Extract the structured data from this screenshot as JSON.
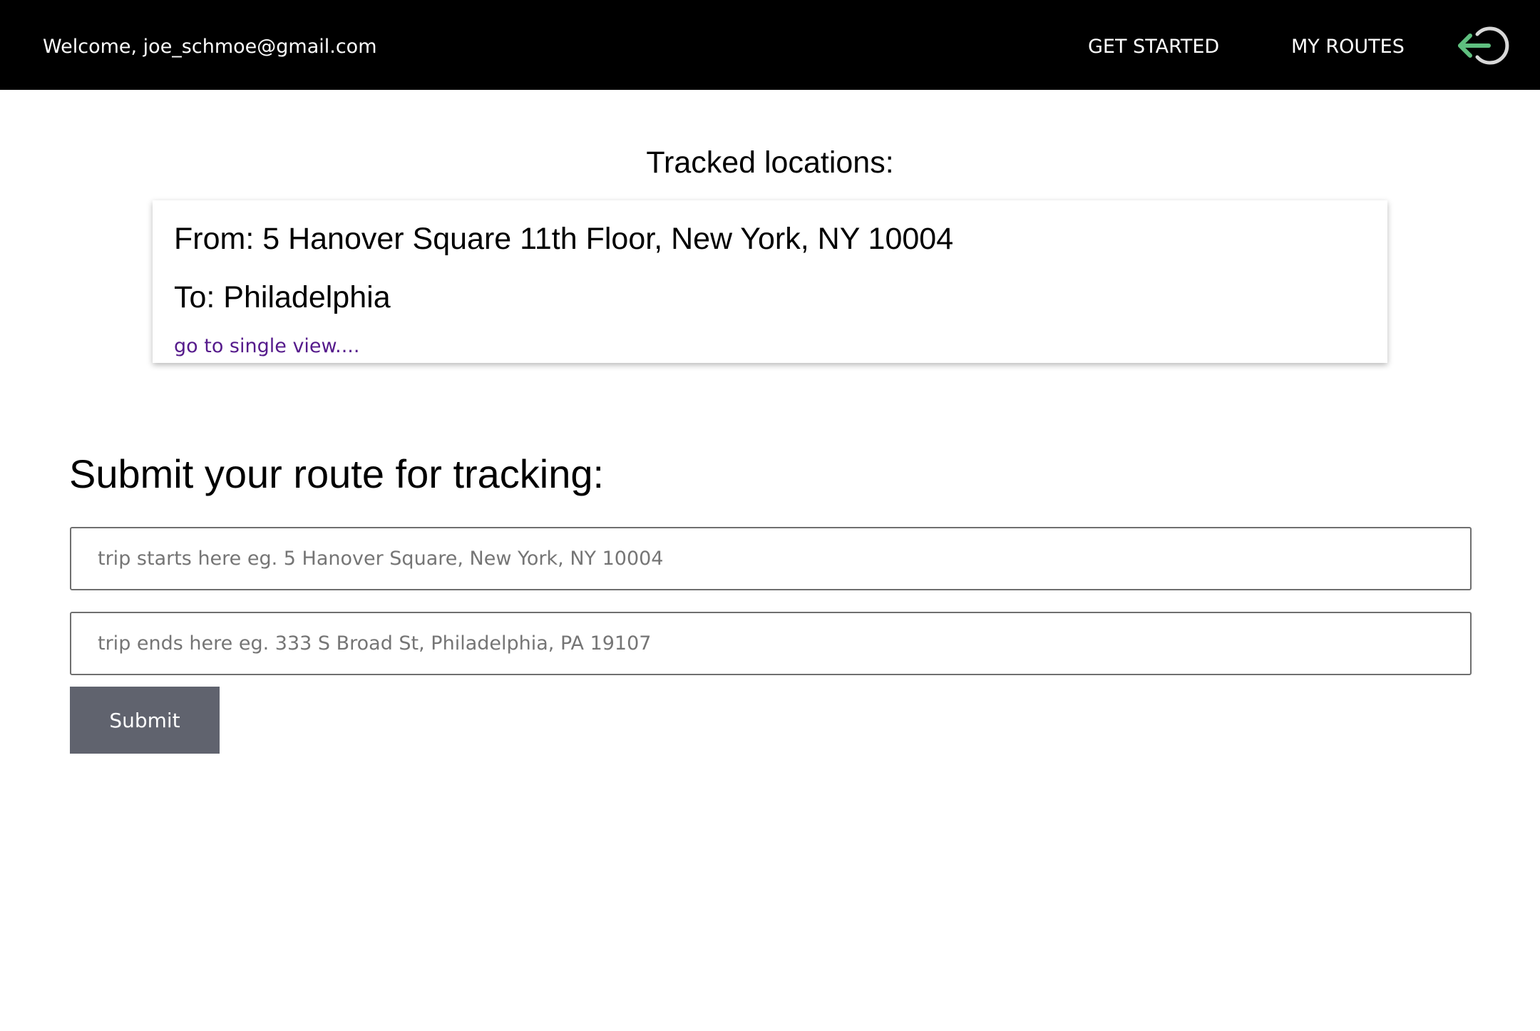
{
  "header": {
    "welcome_text": "Welcome, joe_schmoe@gmail.com",
    "nav": {
      "get_started": "GET STARTED",
      "my_routes": "MY ROUTES"
    },
    "logout_icon": "logout-arrow-circle",
    "logout_arrow_color": "#5fbf7f",
    "logout_ring_color": "#d8d8d8"
  },
  "tracked": {
    "title": "Tracked locations:",
    "routes": [
      {
        "from_text": "From: 5 Hanover Square 11th Floor, New York, NY 10004",
        "to_text": "To: Philadelphia",
        "link_text": "go to single view...."
      }
    ]
  },
  "form": {
    "heading": "Submit your route for tracking:",
    "start_placeholder": "trip starts here eg. 5 Hanover Square, New York, NY 10004",
    "start_value": "",
    "end_placeholder": "trip ends here eg. 333 S Broad St, Philadelphia, PA 19107",
    "end_value": "",
    "submit_label": "Submit",
    "submit_color": "#60636e"
  }
}
